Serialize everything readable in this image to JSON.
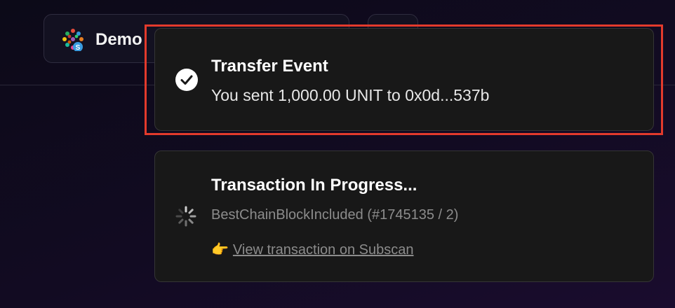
{
  "header": {
    "account_name": "Demo",
    "avatar_icon": "polkadot-identicon-icon"
  },
  "toasts": {
    "success": {
      "icon": "check-circle-icon",
      "title": "Transfer Event",
      "message": "You sent 1,000.00 UNIT to 0x0d...537b"
    },
    "progress": {
      "icon": "spinner-icon",
      "title": "Transaction In Progress...",
      "status": "BestChainBlockIncluded (#1745135 / 2)",
      "link_emoji": "👉",
      "link_label": "View transaction on Subscan"
    }
  },
  "colors": {
    "highlight": "#e33a2c",
    "toast_bg": "#181818",
    "muted_text": "#8c8c8c"
  }
}
